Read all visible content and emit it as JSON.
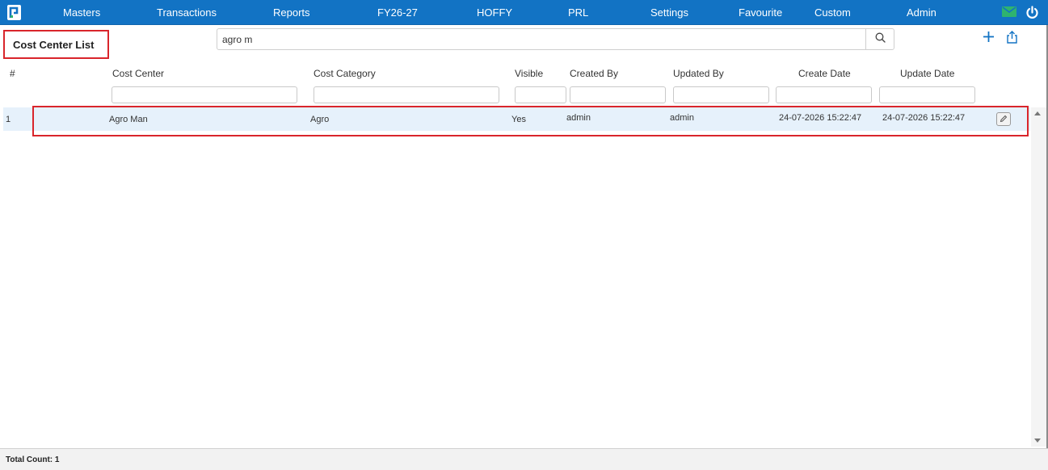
{
  "nav": {
    "items": [
      "Masters",
      "Transactions",
      "Reports",
      "FY26-27",
      "HOFFY",
      "PRL",
      "Settings",
      "Favourite",
      "Custom",
      "Admin"
    ],
    "icons": {
      "logo": "app-logo-icon",
      "mail": "mail-icon",
      "power": "power-icon"
    }
  },
  "page": {
    "title": "Cost Center List"
  },
  "search": {
    "value": "agro m",
    "icon": "search-icon"
  },
  "toolbar": {
    "add_icon": "plus-icon",
    "export_icon": "share-export-icon"
  },
  "table": {
    "columns": [
      "#",
      "Cost Center",
      "Cost Category",
      "Visible",
      "Created By",
      "Updated By",
      "Create Date",
      "Update Date"
    ],
    "rows": [
      {
        "num": "1",
        "cost_center": "Agro Man",
        "cost_category": "Agro",
        "visible": "Yes",
        "created_by": "admin",
        "updated_by": "admin",
        "create_date": "24-07-2026 15:22:47",
        "update_date": "24-07-2026 15:22:47"
      }
    ]
  },
  "footer": {
    "total_count": "Total Count: 1"
  },
  "colors": {
    "nav_bg": "#1273c4",
    "highlight": "#d9252b",
    "row_bg": "#e6f1fb",
    "mail_icon": "#2fb36f"
  }
}
